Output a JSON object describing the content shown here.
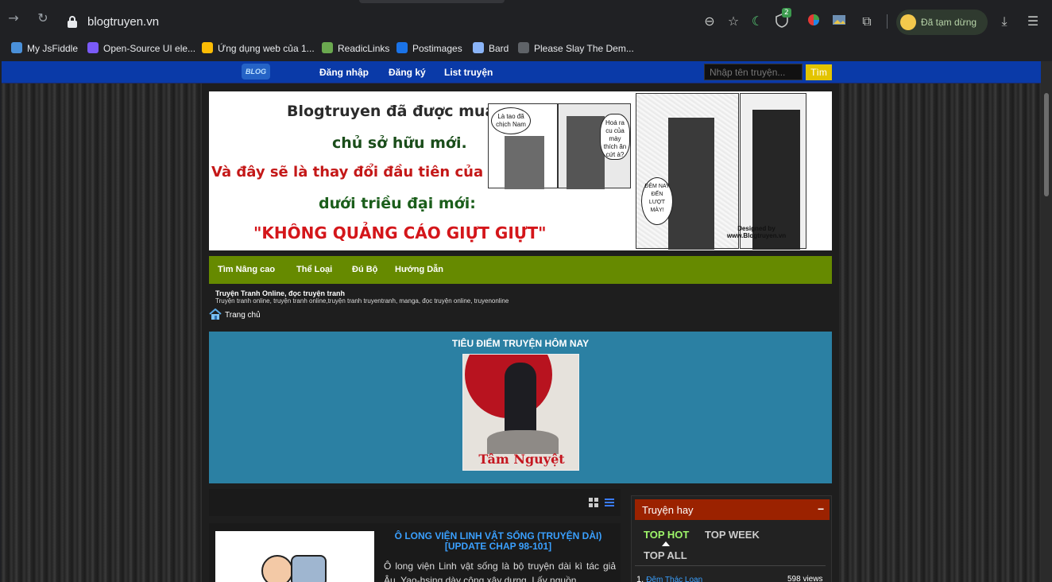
{
  "browser": {
    "url": "blogtruyen.vn",
    "extension_badge": "2",
    "profile_status": "Đã tạm dừng",
    "bookmarks": [
      {
        "label": "My JsFiddle",
        "color": "#4a90d9"
      },
      {
        "label": "Open-Source UI ele...",
        "color": "#7a5af8"
      },
      {
        "label": "Ứng dụng web của 1...",
        "color": "#fbbc05"
      },
      {
        "label": "ReadicLinks",
        "color": "#6aa84f"
      },
      {
        "label": "Postimages",
        "color": "#1a73e8"
      },
      {
        "label": "Bard",
        "color": "#8ab4f8"
      },
      {
        "label": "Please Slay The Dem...",
        "color": "#5f6368"
      }
    ]
  },
  "site": {
    "logo_text": "BLOG",
    "nav": [
      "Đăng nhập",
      "Đăng ký",
      "List truyện"
    ],
    "search_placeholder": "Nhập tên truyện...",
    "search_button": "Tìm",
    "banner": {
      "lines": [
        "Blogtruyen đã được mua bởi",
        "chủ sở hữu mới.",
        "Và đây sẽ là thay đổi đầu tiên của BlogTruyen.vn",
        "dưới triều đại mới:",
        "\"KHÔNG QUẢNG CÁO GIỰT GIỰT\""
      ],
      "bubble_1": "Là tao đã chịch Nam",
      "bubble_2": "Hoá ra cu của mày thích ăn cứt à?",
      "bubble_3": "ĐÊM NAY ĐẾN LƯỢT MÀY!",
      "credit": "Designed by www.Blogtruyen.vn"
    },
    "green_nav": [
      "Tìm Nâng cao",
      "Thể Loại",
      "Đú Bộ",
      "Hướng Dẫn"
    ],
    "tagline_title": "Truyện Tranh Online, đọc truyện tranh",
    "tagline_body": "Truyện tranh online, truyện tranh online,truyện tranh truyentranh, manga, đọc truyện online, truyenonline",
    "breadcrumb": "Trang chủ",
    "featured_title": "TIÊU ĐIỂM TRUYỆN HÔM NAY",
    "featured_cover_text": "Tâm Nguyệt",
    "story": {
      "title": "Ô LONG VIỆN LINH VẬT SỐNG (TRUYỆN DÀI) [UPDATE CHAP 98-101]",
      "description": "Ô long viện Linh vật sống là bộ truyện dài kì tác giả Âu, Yao-hsing dày công xây dựng. Lấy nguồn"
    },
    "sidebar": {
      "heading": "Truyện hay",
      "collapse": "−",
      "tabs": [
        "TOP HOT",
        "TOP WEEK",
        "TOP ALL"
      ],
      "top_item_rank": "1.",
      "top_item_name": "Đêm Thác Loạn",
      "top_item_views": "598 views"
    }
  },
  "colors": {
    "topbar": "#0a3aa8",
    "green_nav": "#668a00",
    "featured": "#2b80a3",
    "sidebar_head": "#9b2200",
    "active_tab": "#9ef56a",
    "story_title": "#3aa0ff"
  }
}
